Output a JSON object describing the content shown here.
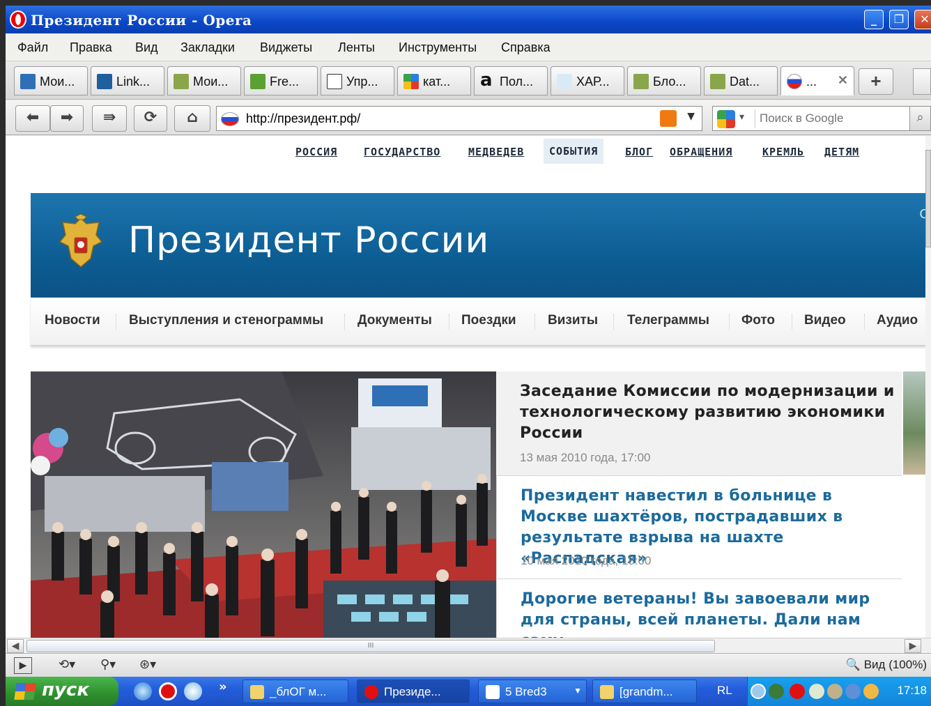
{
  "window": {
    "title": "Президент России - Opera"
  },
  "menu": [
    "Файл",
    "Правка",
    "Вид",
    "Закладки",
    "Виджеты",
    "Ленты",
    "Инструменты",
    "Справка"
  ],
  "tabs": [
    {
      "label": "Мои...",
      "icon": "grid-icon",
      "color": "#2f6fb6"
    },
    {
      "label": "Link...",
      "icon": "linkedin-icon",
      "color": "#1f5f9c"
    },
    {
      "label": "Мои...",
      "icon": "document-icon",
      "color": "#8aa54a"
    },
    {
      "label": "Fre...",
      "icon": "freelance-icon",
      "color": "#5aa032"
    },
    {
      "label": "Упр...",
      "icon": "tl-icon",
      "color": "#333333"
    },
    {
      "label": "кат...",
      "icon": "google-icon",
      "color": "#3c8cd8"
    },
    {
      "label": "Пол...",
      "icon": "a-letter-icon",
      "color": "#111111"
    },
    {
      "label": "ХАР...",
      "icon": "x-star-icon",
      "color": "#9bc3df"
    },
    {
      "label": "Бло...",
      "icon": "document-icon",
      "color": "#8aa54a"
    },
    {
      "label": "Dat...",
      "icon": "document-icon",
      "color": "#8aa54a"
    },
    {
      "label": "...",
      "icon": "russia-flag-icon",
      "color": "#d42020",
      "active": true
    }
  ],
  "address": {
    "url": "http://президент.рф/",
    "search_placeholder": "Поиск в Google"
  },
  "site": {
    "top_links": [
      "РОССИЯ",
      "ГОСУДАРСТВО",
      "МЕДВЕДЕВ",
      "СОБЫТИЯ",
      "БЛОГ",
      "ОБРАЩЕНИЯ",
      "КРЕМЛЬ",
      "ДЕТЯМ"
    ],
    "current_top_link": "СОБЫТИЯ",
    "banner_title": "Президент России",
    "banner_cut": "С",
    "main_nav": [
      "Новости",
      "Выступления и стенограммы",
      "Документы",
      "Поездки",
      "Визиты",
      "Телеграммы",
      "Фото",
      "Видео",
      "Аудио"
    ],
    "news": [
      {
        "title": "Заседание Комиссии по модернизации и технологическому развитию экономики России",
        "date": "13 мая 2010 года, 17:00",
        "color": "#222222"
      },
      {
        "title": "Президент навестил в больнице в Москве шахтёров, пострадавших в результате взрыва на шахте «Распадская»",
        "date": "10 мая 2010 года, 18:00",
        "color": "#1b6a9c"
      },
      {
        "title": "Дорогие ветераны! Вы завоевали мир для страны, всей планеты. Дали нам саму",
        "date": "",
        "color": "#1b6a9c"
      }
    ]
  },
  "scrollbar": {
    "grip": "III"
  },
  "status": {
    "zoom_label": "Вид (100%)"
  },
  "taskbar": {
    "start_label": "пуск",
    "chevron": "»",
    "tasks": [
      {
        "label": "_блОГ м...",
        "color": "#f2d36b"
      },
      {
        "label": "Президе...",
        "color": "#e01010",
        "active": true
      },
      {
        "label": "5 Bred3",
        "color": "#ffffff"
      },
      {
        "label": "[grandm...",
        "color": "#f2d36b"
      }
    ],
    "lang": "RL",
    "clock": "17:18"
  }
}
